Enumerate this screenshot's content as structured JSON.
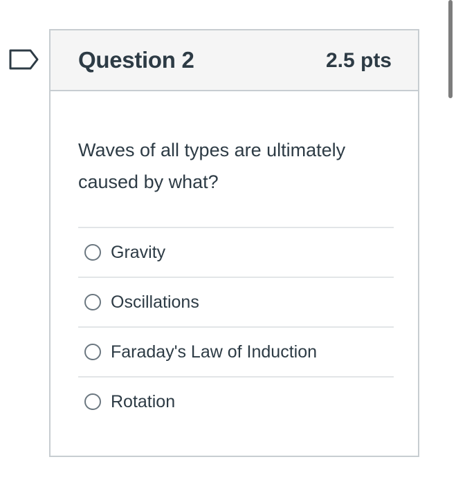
{
  "question": {
    "title": "Question 2",
    "points": "2.5 pts",
    "text": "Waves of all types are ultimately caused by what?",
    "flag_icon": "flag-outline-icon",
    "answers": [
      {
        "label": "Gravity",
        "selected": false
      },
      {
        "label": "Oscillations",
        "selected": false
      },
      {
        "label": "Faraday's Law of Induction",
        "selected": false
      },
      {
        "label": "Rotation",
        "selected": false
      }
    ]
  },
  "colors": {
    "text": "#2d3b45",
    "header_bg": "#f5f5f5",
    "border": "#c7cdd1",
    "divider": "#e2e5e7",
    "flag": "#2d3b45"
  }
}
